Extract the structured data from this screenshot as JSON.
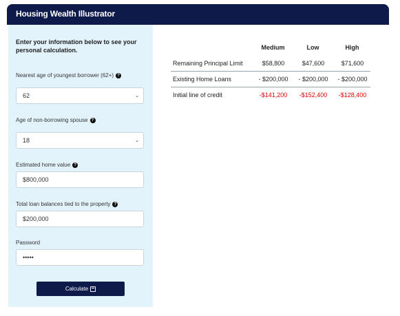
{
  "header": {
    "title": "Housing Wealth Illustrator"
  },
  "form": {
    "intro": "Enter your information below to see your personal calculation.",
    "age_label": "Nearest age of youngest borrower (62+)",
    "age_value": "62",
    "spouse_label": "Age of non-borrowing spouse",
    "spouse_value": "18",
    "home_value_label": "Estimated home value",
    "home_value": "$800,000",
    "loan_balance_label": "Total loan balances tied to the property",
    "loan_balance": "$200,000",
    "password_label": "Password",
    "password_value": "•••••",
    "calculate_label": "Calculate"
  },
  "results": {
    "columns": [
      "Medium",
      "Low",
      "High"
    ],
    "rows": [
      {
        "label": "Remaining Principal Limit",
        "values": [
          "$58,800",
          "$47,600",
          "$71,600"
        ]
      },
      {
        "label": "Existing Home Loans",
        "values": [
          "- $200,000",
          "- $200,000",
          "- $200,000"
        ]
      },
      {
        "label": "Initial line of credit",
        "values": [
          "-$141,200",
          "-$152,400",
          "-$128,400"
        ]
      }
    ],
    "negative_color": "#e00000"
  },
  "colors": {
    "navy": "#0d1a4a",
    "panel": "#e3f3fc"
  }
}
